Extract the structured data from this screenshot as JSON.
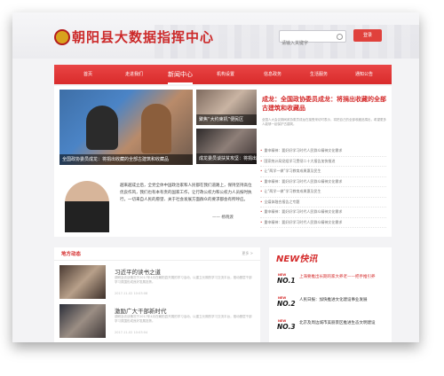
{
  "header": {
    "site_title": "朝阳县大数据指挥中心",
    "search_placeholder": "请输入关键字",
    "login_label": "登录"
  },
  "nav": {
    "items": [
      "首页",
      "走进我们",
      "新闻中心",
      "机构设置",
      "信息政务",
      "生活服务",
      "通知公告"
    ],
    "active_index": 2
  },
  "featured": {
    "main_caption": "全国政协委员成龙：将捐出收藏的全部古建筑和收藏品",
    "small_caption_1": "聚焦“大约束机”便民区",
    "small_caption_2": "成龙委员谈扶贫攻坚：将捐出",
    "headline": "成龙：全国政协委员成龙：将捐出收藏的全部古建筑和收藏品",
    "summary": "全国人大会议期间政协委员成龙在接受采访时表示，将把自己的全部收藏品捐出，希望更多人能够一起保护古建筑。"
  },
  "news_list": [
    "重申精神：要好好学习时代人民群众精神文化需求",
    "国家统计局党组学习贯彻二十大报告加快推进",
    "让“两学一做”学习教育成果惠及民生",
    "重申精神：要好好学习时代人民群众精神文化需求",
    "让“两学一做”学习教育成果惠及民生",
    "全媒体融合报告之专题",
    "重申精神：要好好学习时代人民群众精神文化需求",
    "重申精神：要好好学习时代人民群众精神文化需求"
  ],
  "quote": {
    "text": "越来越成立后，全党全体中国政治家和人民都在我们道路上，保持坚持高位优良作风，我们也有本有责的国家工作，让行政公权力和公权力人员按时执行，一切来自人民的愿望、关于社会发展方面群众的要求都会有所呼应。",
    "signature": "—— 杨晓渡"
  },
  "local_news": {
    "title": "地方动态",
    "more": "更多 >",
    "articles": [
      {
        "title": "习近平的读书之道",
        "desc": "调研及访谈情况于2017年4月在朝阳县开展的学习活动，以建立长期的学习交流平台，推动基层干部学习氛围形成良好发展态势。",
        "date": "2017-11-02 10:03:08"
      },
      {
        "title": "激励广大干部新时代",
        "desc": "调研及访谈情况于2017年4月在朝阳县开展的学习活动，以建立长期的学习交流平台，推动基层干部学习氛围形成良好发展态势。",
        "date": "2017-11-02 10:03:04"
      }
    ]
  },
  "flash_news": {
    "title": "NEW快讯",
    "items": [
      {
        "badge_small": "NEW",
        "rank": "NO.1",
        "text": "上海要推出长期的家大养老——把手推引养"
      },
      {
        "badge_small": "NEW",
        "rank": "NO.2",
        "text": "人民日报：加快推进文化建设事业发展"
      },
      {
        "badge_small": "NEW",
        "rank": "NO.3",
        "text": "北京及周边城市美丽景区推进生态文明建设"
      }
    ]
  },
  "colors": {
    "brand_red": "#d42a2a",
    "nav_red": "#e94545"
  }
}
